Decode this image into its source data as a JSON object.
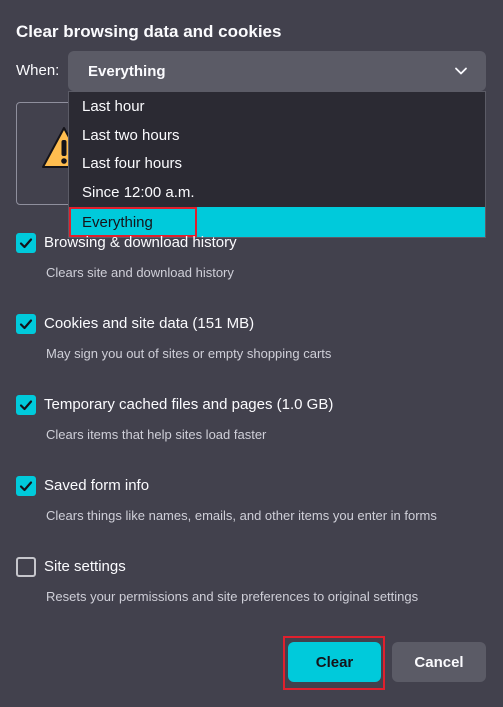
{
  "dialog": {
    "title": "Clear browsing data and cookies",
    "when_label": "When:",
    "when_value": "Everything"
  },
  "dropdown": {
    "options": [
      "Last hour",
      "Last two hours",
      "Last four hours",
      "Since 12:00 a.m.",
      "Everything"
    ],
    "selected": "Everything"
  },
  "items": [
    {
      "label": "Browsing & download history",
      "desc": "Clears site and download history",
      "checked": true
    },
    {
      "label": "Cookies and site data (151 MB)",
      "desc": "May sign you out of sites or empty shopping carts",
      "checked": true
    },
    {
      "label": "Temporary cached files and pages (1.0 GB)",
      "desc": "Clears items that help sites load faster",
      "checked": true
    },
    {
      "label": "Saved form info",
      "desc": "Clears things like names, emails, and other items you enter in forms",
      "checked": true
    },
    {
      "label": "Site settings",
      "desc": "Resets your permissions and site preferences to original settings",
      "checked": false
    }
  ],
  "buttons": {
    "clear": "Clear",
    "cancel": "Cancel"
  },
  "icons": {
    "warning": "warning-icon",
    "chevron": "chevron-down-icon",
    "check": "checkmark-icon"
  },
  "colors": {
    "accent": "#00cadb",
    "background": "#42414d",
    "highlight": "#e0202d"
  }
}
